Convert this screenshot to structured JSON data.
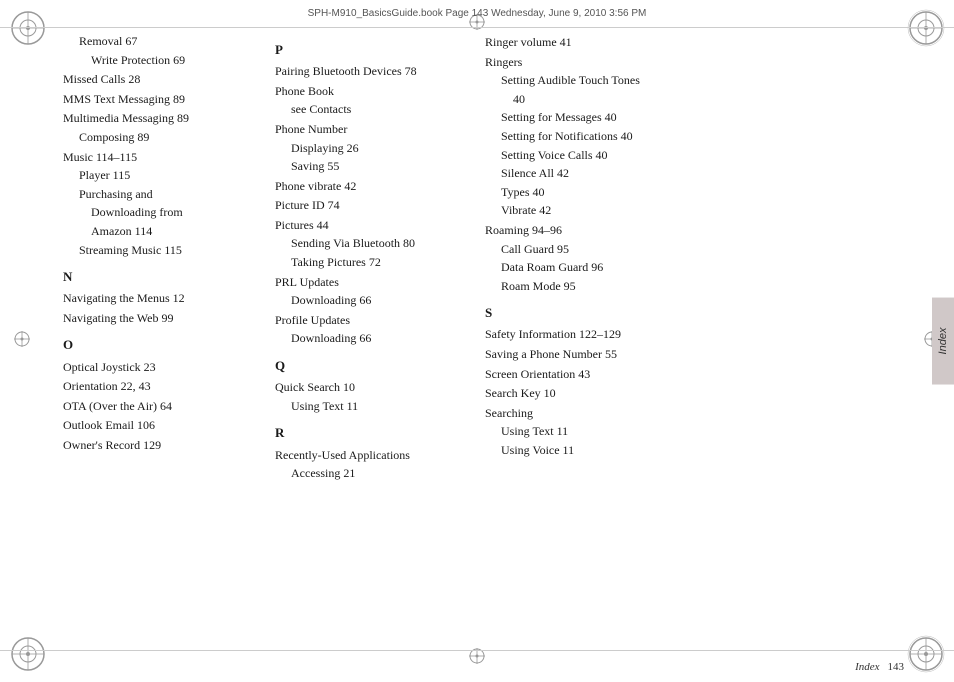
{
  "header": {
    "text": "SPH-M910_BasicsGuide.book  Page 143  Wednesday, June 9, 2010  3:56 PM"
  },
  "footer": {
    "label": "Index",
    "page": "143"
  },
  "index_tab": "Index",
  "columns": {
    "left": {
      "entries": [
        {
          "level": "sub",
          "text": "Removal 67"
        },
        {
          "level": "sub-sub",
          "text": "Write Protection 69"
        },
        {
          "level": "main",
          "text": "Missed Calls 28"
        },
        {
          "level": "main",
          "text": "MMS Text Messaging 89"
        },
        {
          "level": "main",
          "text": "Multimedia Messaging 89"
        },
        {
          "level": "sub",
          "text": "Composing 89"
        },
        {
          "level": "main",
          "text": "Music 114–115"
        },
        {
          "level": "sub",
          "text": "Player 115"
        },
        {
          "level": "sub",
          "text": "Purchasing and"
        },
        {
          "level": "sub-sub",
          "text": "Downloading from"
        },
        {
          "level": "sub-sub",
          "text": "Amazon 114"
        },
        {
          "level": "sub",
          "text": "Streaming Music 115"
        },
        {
          "level": "section",
          "text": "N"
        },
        {
          "level": "main",
          "text": "Navigating the Menus 12"
        },
        {
          "level": "main",
          "text": "Navigating the Web 99"
        },
        {
          "level": "section",
          "text": "O"
        },
        {
          "level": "main",
          "text": "Optical Joystick 23"
        },
        {
          "level": "main",
          "text": "Orientation 22, 43"
        },
        {
          "level": "main",
          "text": "OTA (Over the Air) 64"
        },
        {
          "level": "main",
          "text": "Outlook Email 106"
        },
        {
          "level": "main",
          "text": "Owner's Record 129"
        }
      ]
    },
    "middle": {
      "entries": [
        {
          "level": "section",
          "text": "P"
        },
        {
          "level": "main",
          "text": "Pairing Bluetooth Devices 78"
        },
        {
          "level": "main",
          "text": "Phone Book"
        },
        {
          "level": "sub",
          "text": "see Contacts"
        },
        {
          "level": "main",
          "text": "Phone Number"
        },
        {
          "level": "sub",
          "text": "Displaying 26"
        },
        {
          "level": "sub",
          "text": "Saving 55"
        },
        {
          "level": "main",
          "text": "Phone vibrate 42"
        },
        {
          "level": "main",
          "text": "Picture ID 74"
        },
        {
          "level": "main",
          "text": "Pictures 44"
        },
        {
          "level": "sub",
          "text": "Sending Via Bluetooth 80"
        },
        {
          "level": "sub",
          "text": "Taking Pictures 72"
        },
        {
          "level": "main",
          "text": "PRL Updates"
        },
        {
          "level": "sub",
          "text": "Downloading 66"
        },
        {
          "level": "main",
          "text": "Profile Updates"
        },
        {
          "level": "sub",
          "text": "Downloading 66"
        },
        {
          "level": "section",
          "text": "Q"
        },
        {
          "level": "main",
          "text": "Quick Search 10"
        },
        {
          "level": "sub",
          "text": "Using Text 11"
        },
        {
          "level": "section",
          "text": "R"
        },
        {
          "level": "main",
          "text": "Recently-Used Applications"
        },
        {
          "level": "sub",
          "text": "Accessing 21"
        }
      ]
    },
    "right": {
      "entries": [
        {
          "level": "main",
          "text": "Ringer volume 41"
        },
        {
          "level": "main",
          "text": "Ringers"
        },
        {
          "level": "sub",
          "text": "Setting Audible Touch Tones"
        },
        {
          "level": "sub-sub",
          "text": "40"
        },
        {
          "level": "sub",
          "text": "Setting for Messages 40"
        },
        {
          "level": "sub",
          "text": "Setting for Notifications 40"
        },
        {
          "level": "sub",
          "text": "Setting Voice Calls 40"
        },
        {
          "level": "sub",
          "text": "Silence All 42"
        },
        {
          "level": "sub",
          "text": "Types 40"
        },
        {
          "level": "sub",
          "text": "Vibrate 42"
        },
        {
          "level": "main",
          "text": "Roaming 94–96"
        },
        {
          "level": "sub",
          "text": "Call Guard 95"
        },
        {
          "level": "sub",
          "text": "Data Roam Guard 96"
        },
        {
          "level": "sub",
          "text": "Roam Mode 95"
        },
        {
          "level": "section",
          "text": "S"
        },
        {
          "level": "main",
          "text": "Safety Information 122–129"
        },
        {
          "level": "main",
          "text": "Saving a Phone Number 55"
        },
        {
          "level": "main",
          "text": "Screen Orientation 43"
        },
        {
          "level": "main",
          "text": "Search Key 10"
        },
        {
          "level": "main",
          "text": "Searching"
        },
        {
          "level": "sub",
          "text": "Using Text 11"
        },
        {
          "level": "sub",
          "text": "Using Voice 11"
        }
      ]
    }
  }
}
